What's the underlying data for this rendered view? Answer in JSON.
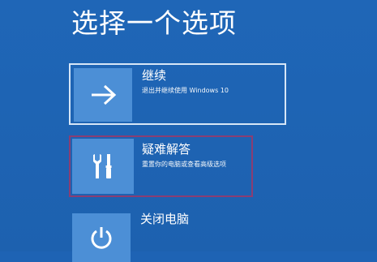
{
  "page": {
    "title": "选择一个选项"
  },
  "options": [
    {
      "title": "继续",
      "description": "退出并继续使用 Windows 10",
      "icon": "arrow-right-icon"
    },
    {
      "title": "疑难解答",
      "description": "重置你的电脑或查看高级选项",
      "icon": "tools-icon"
    },
    {
      "title": "关闭电脑",
      "description": "",
      "icon": "power-icon"
    }
  ],
  "colors": {
    "background": "#1e63b4",
    "tile": "#4c8fd6",
    "selected_border": "#d6e6f7",
    "highlight_border": "#8a3e73"
  }
}
